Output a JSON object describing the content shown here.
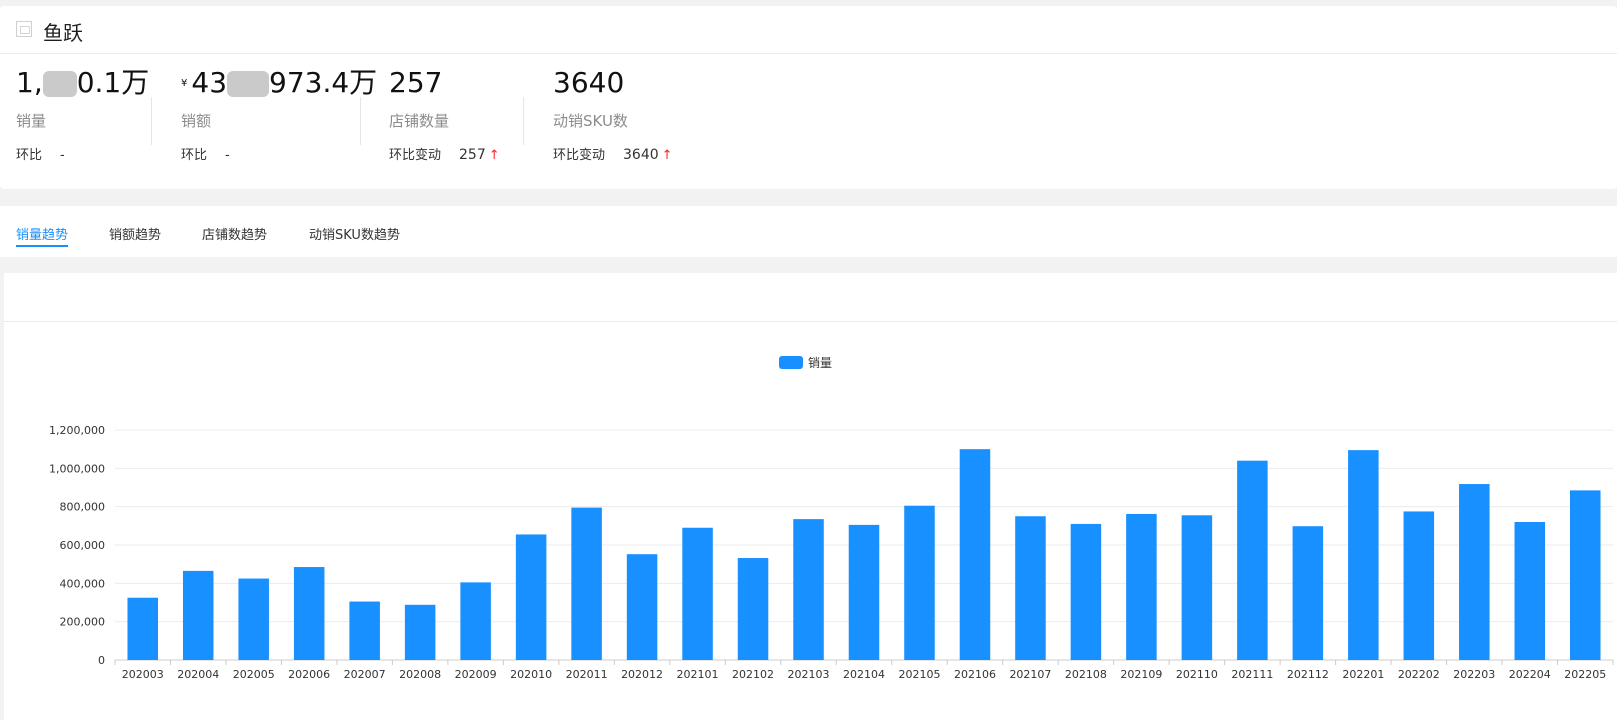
{
  "header": {
    "brand_name": "鱼跃",
    "brand_icon": "store-icon"
  },
  "metrics": [
    {
      "value_prefix": "1,",
      "value_suffix": "0.1万",
      "label": "销量",
      "compare_label": "环比",
      "compare_value": "-"
    },
    {
      "currency": "¥",
      "value_prefix": "43",
      "value_suffix": "973.4万",
      "label": "销额",
      "compare_label": "环比",
      "compare_value": "-"
    },
    {
      "value": "257",
      "label": "店铺数量",
      "compare_label": "环比变动",
      "compare_value": "257",
      "trend_icon": "up-arrow-icon",
      "trend_glyph": "↑"
    },
    {
      "value": "3640",
      "label": "动销SKU数",
      "compare_label": "环比变动",
      "compare_value": "3640",
      "trend_icon": "up-arrow-icon",
      "trend_glyph": "↑"
    }
  ],
  "tabs": [
    "销量趋势",
    "销额趋势",
    "店铺数趋势",
    "动销SKU数趋势"
  ],
  "active_tab": 0,
  "colors": {
    "accent": "#1890ff",
    "bar": "#1890ff",
    "up": "#f5222d"
  },
  "chart_data": {
    "type": "bar",
    "legend": [
      "销量"
    ],
    "legend_position": "top-center",
    "categories": [
      "202003",
      "202004",
      "202005",
      "202006",
      "202007",
      "202008",
      "202009",
      "202010",
      "202011",
      "202012",
      "202101",
      "202102",
      "202103",
      "202104",
      "202105",
      "202106",
      "202107",
      "202108",
      "202109",
      "202110",
      "202111",
      "202112",
      "202201",
      "202202",
      "202203",
      "202204",
      "202205"
    ],
    "series": [
      {
        "name": "销量",
        "values": [
          325000,
          465000,
          425000,
          485000,
          305000,
          288000,
          405000,
          655000,
          795000,
          552000,
          690000,
          532000,
          735000,
          705000,
          805000,
          1100000,
          750000,
          710000,
          762000,
          755000,
          1040000,
          698000,
          1095000,
          775000,
          918000,
          720000,
          885000
        ]
      }
    ],
    "yticks": [
      "0",
      "200,000",
      "400,000",
      "600,000",
      "800,000",
      "1,000,000",
      "1,200,000"
    ],
    "ylim": [
      0,
      1200000
    ],
    "grid": true
  }
}
